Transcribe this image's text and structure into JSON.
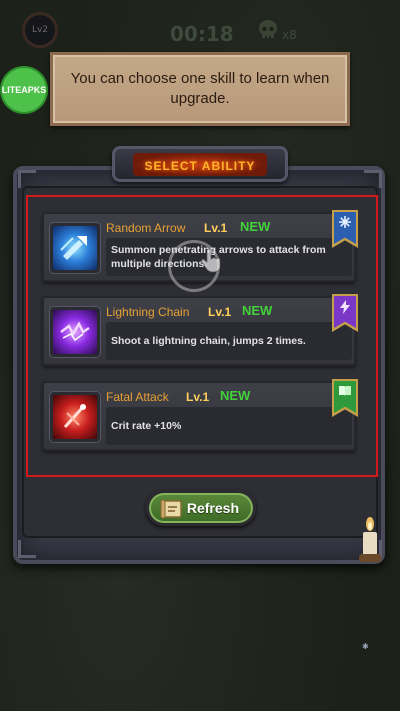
{
  "hud": {
    "level": "Lv2",
    "timer": "00:18",
    "kill_count": "x8"
  },
  "watermark": {
    "label": "LITEAPKS"
  },
  "tooltip": {
    "text": "You can choose one skill to learn when upgrade."
  },
  "panel": {
    "title": "SELECT ABILITY",
    "skills": [
      {
        "name": "Random Arrow",
        "level": "Lv.1",
        "badge": "NEW",
        "description": "Summon penetrating arrows to attack from multiple directions.",
        "icon": "arrow-icon",
        "banner_icon": "snowflake-icon",
        "banner_color": "#2d5fb0"
      },
      {
        "name": "Lightning Chain",
        "level": "Lv.1",
        "badge": "NEW",
        "description": "Shoot a lightning chain, jumps 2 times.",
        "icon": "lightning-icon",
        "banner_icon": "bolt-icon",
        "banner_color": "#7a37c8"
      },
      {
        "name": "Fatal Attack",
        "level": "Lv.1",
        "badge": "NEW",
        "description": "Crit rate +10%",
        "icon": "fatal-attack-icon",
        "banner_icon": "book-icon",
        "banner_color": "#2f9a3c"
      }
    ],
    "refresh_label": "Refresh"
  },
  "colors": {
    "skill_name": "#e8a234",
    "level": "#ffcf5a",
    "new_badge": "#43d13a",
    "highlight_frame": "#d11a1a",
    "refresh_button": "#4f7d33"
  }
}
